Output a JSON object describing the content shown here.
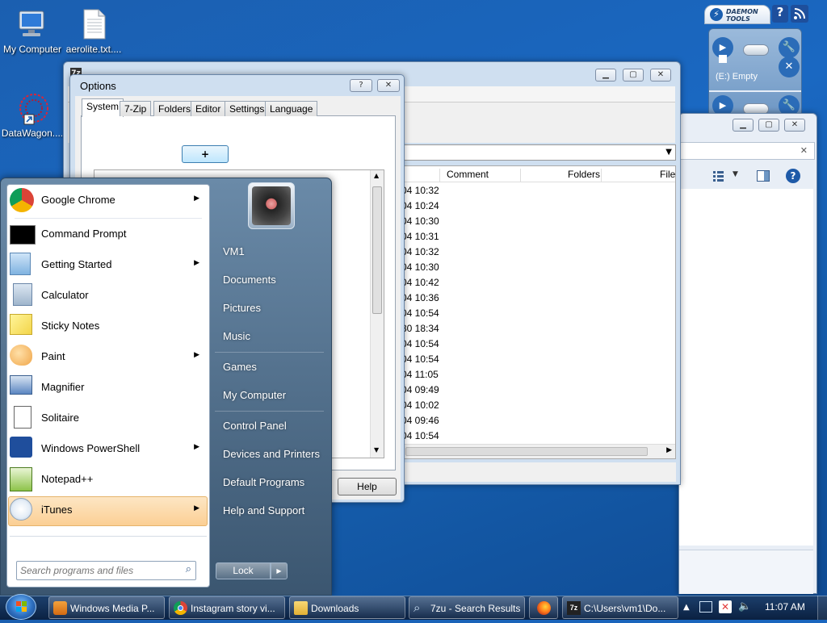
{
  "desktop": {
    "icons": [
      {
        "label": "My Computer"
      },
      {
        "label": "aerolite.txt...."
      },
      {
        "label": "DataWagon...."
      }
    ]
  },
  "daemon": {
    "brand": "DAEMON TOOLS",
    "drive_label": "(E:) Empty",
    "help_glyph": "?"
  },
  "explorer": {
    "columns": [
      "Comment",
      "Folders",
      "File"
    ],
    "times": [
      "04 10:32",
      "04 10:24",
      "04 10:30",
      "04 10:31",
      "04 10:32",
      "04 10:30",
      "04 10:42",
      "04 10:36",
      "04 10:54",
      "30 18:34",
      "04 10:54",
      "04 10:54",
      "04 11:05",
      "04 09:49",
      "04 10:02",
      "04 09:46",
      "04 10:54"
    ]
  },
  "options": {
    "title": "Options",
    "help_glyph": "?",
    "tabs": [
      "System",
      "7-Zip",
      "Folders",
      "Editor",
      "Settings",
      "Language"
    ],
    "plus_button": "+",
    "help_button": "Help"
  },
  "start_menu": {
    "programs": [
      {
        "label": "Google Chrome",
        "arrow": "▶"
      },
      {
        "label": "Command Prompt",
        "arrow": ""
      },
      {
        "label": "Getting Started",
        "arrow": "▶"
      },
      {
        "label": "Calculator",
        "arrow": ""
      },
      {
        "label": "Sticky Notes",
        "arrow": ""
      },
      {
        "label": "Paint",
        "arrow": "▶"
      },
      {
        "label": "Magnifier",
        "arrow": ""
      },
      {
        "label": "Solitaire",
        "arrow": ""
      },
      {
        "label": "Windows PowerShell",
        "arrow": "▶"
      },
      {
        "label": "Notepad++",
        "arrow": ""
      },
      {
        "label": "iTunes",
        "arrow": "▶"
      }
    ],
    "search_placeholder": "Search programs and files",
    "right_items": [
      "VM1",
      "Documents",
      "Pictures",
      "Music",
      "Games",
      "My Computer",
      "Control Panel",
      "Devices and Printers",
      "Default Programs",
      "Help and Support"
    ],
    "lock_label": "Lock",
    "lock_arrow": "▶"
  },
  "taskbar": {
    "items": [
      {
        "label": "Windows Media P..."
      },
      {
        "label": "Instagram story vi..."
      },
      {
        "label": "Downloads"
      },
      {
        "label": "7zu - Search Results"
      },
      {
        "label": "C:\\Users\\vm1\\Do..."
      }
    ],
    "clock": "11:07 AM",
    "tray_arrow": "▲"
  },
  "colors": {
    "accent_highlight": "#fcd9a8",
    "start_menu_right": "#3b5670"
  }
}
